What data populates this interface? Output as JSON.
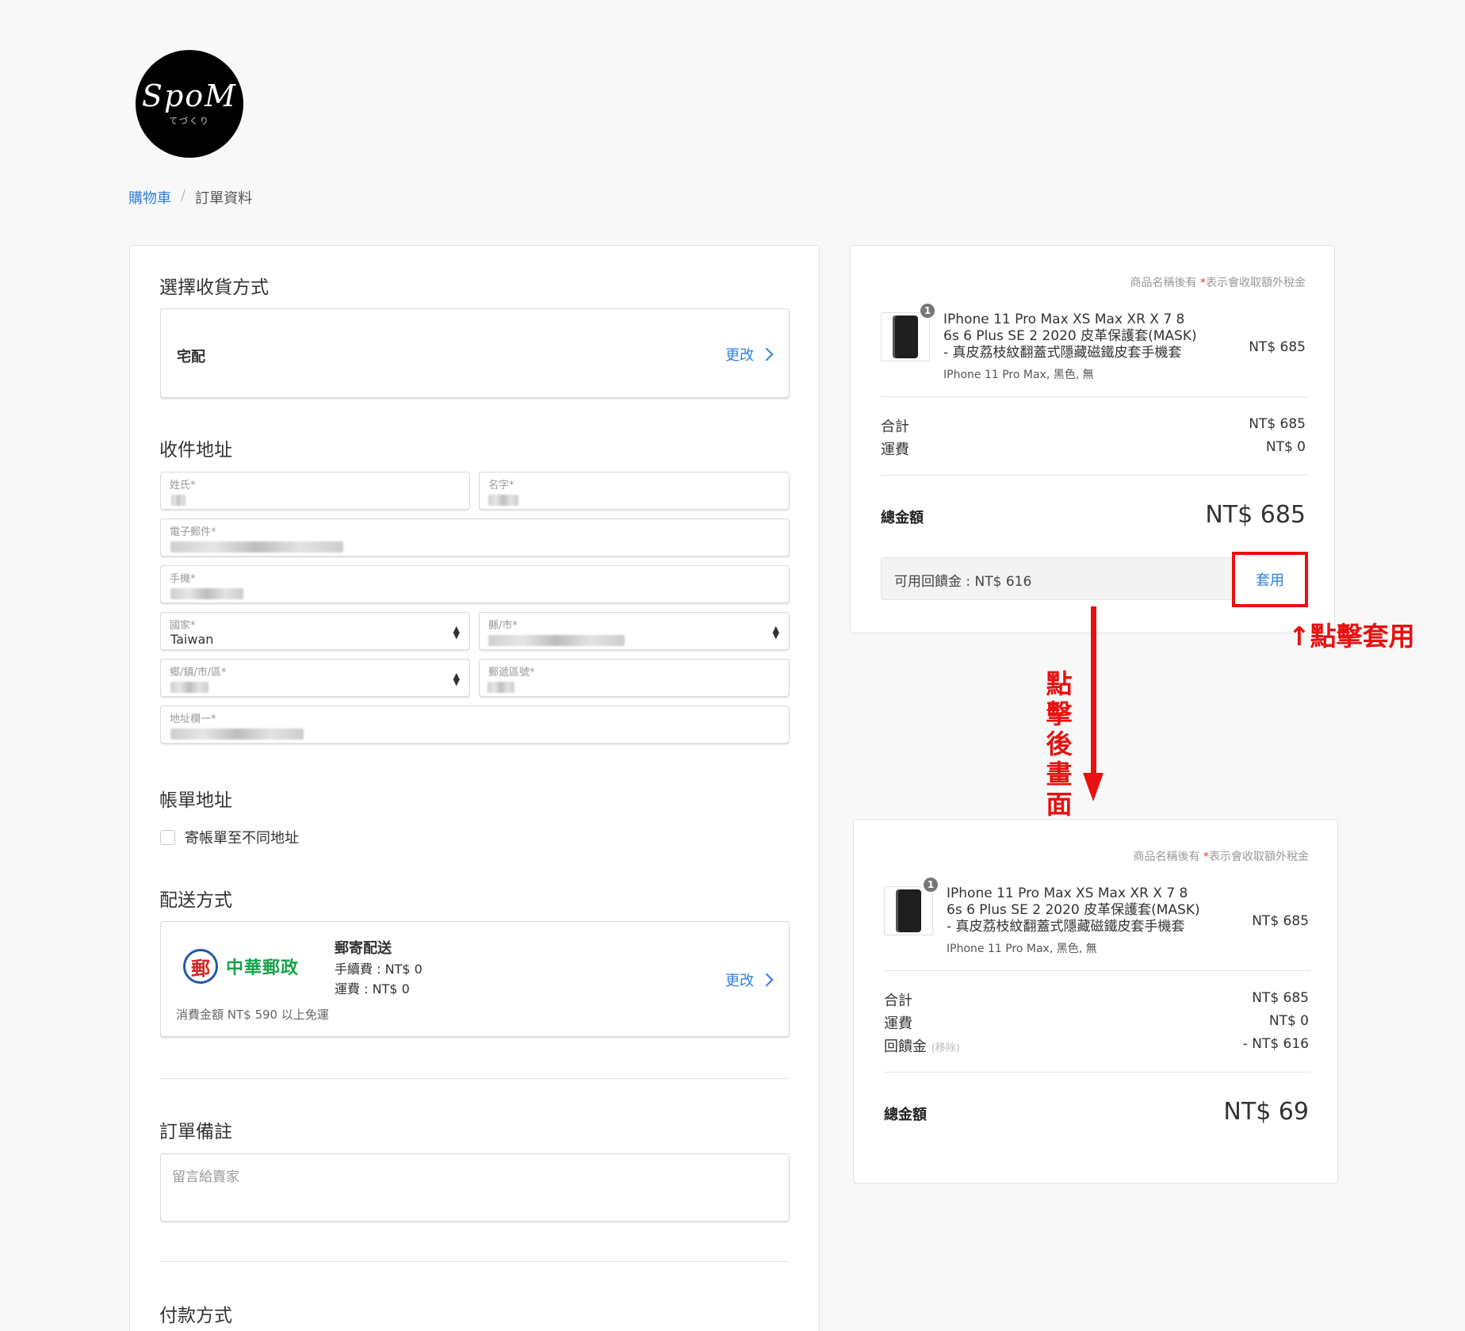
{
  "logo": {
    "main": "SpoM",
    "sub": "てづくり"
  },
  "breadcrumb": {
    "cart": "購物車",
    "separator": "/",
    "current": "訂單資料"
  },
  "receive": {
    "title": "選擇收貨方式",
    "method": "宅配",
    "change": "更改"
  },
  "address": {
    "title": "收件地址",
    "last_name_label": "姓氏*",
    "first_name_label": "名字*",
    "email_label": "電子郵件*",
    "phone_label": "手機*",
    "country_label": "國家*",
    "country_value": "Taiwan",
    "city_label": "縣/市*",
    "district_label": "鄉/鎮/市/區*",
    "zip_label": "郵遞區號*",
    "address_label": "地址欄一*"
  },
  "billing": {
    "title": "帳單地址",
    "checkbox_label": "寄帳單至不同地址"
  },
  "delivery": {
    "title": "配送方式",
    "carrier_logo": "中華郵政",
    "carrier_glyph": "郵",
    "name": "郵寄配送",
    "handling_fee": "手續費 : NT$ 0",
    "shipping_fee": "運費 : NT$ 0",
    "free_note": "消費金額 NT$ 590 以上免運",
    "change": "更改"
  },
  "note": {
    "title": "訂單備註",
    "placeholder": "留言給賣家"
  },
  "payment": {
    "title": "付款方式"
  },
  "summary_before": {
    "tax_note_prefix": "商品名稱後有 ",
    "tax_note_star": "*",
    "tax_note_suffix": "表示會收取額外稅金",
    "qty": "1",
    "item_name": "IPhone 11 Pro Max XS Max XR X 7 8 6s 6 Plus SE 2 2020 皮革保護套(MASK) - 真皮荔枝紋翻蓋式隱藏磁鐵皮套手機套",
    "item_variant": "IPhone 11 Pro Max, 黑色, 無",
    "item_price": "NT$ 685",
    "subtotal_label": "合計",
    "subtotal": "NT$ 685",
    "shipping_label": "運費",
    "shipping": "NT$ 0",
    "total_label": "總金額",
    "total": "NT$ 685",
    "credit_text": "可用回饋金 : NT$ 616",
    "apply": "套用"
  },
  "summary_after": {
    "tax_note_prefix": "商品名稱後有 ",
    "tax_note_star": "*",
    "tax_note_suffix": "表示會收取額外稅金",
    "qty": "1",
    "item_name": "IPhone 11 Pro Max XS Max XR X 7 8 6s 6 Plus SE 2 2020 皮革保護套(MASK) - 真皮荔枝紋翻蓋式隱藏磁鐵皮套手機套",
    "item_variant": "IPhone 11 Pro Max, 黑色, 無",
    "item_price": "NT$ 685",
    "subtotal_label": "合計",
    "subtotal": "NT$ 685",
    "shipping_label": "運費",
    "shipping": "NT$ 0",
    "credit_label": "回饋金",
    "credit_remove": "(移除)",
    "credit": "- NT$ 616",
    "total_label": "總金額",
    "total": "NT$ 69"
  },
  "annotations": {
    "click_apply": "↑點擊套用",
    "after_click": "點擊後畫面"
  },
  "colors": {
    "link": "#2f7fe0",
    "annotation": "#e81010",
    "post_green": "#18a14a"
  }
}
